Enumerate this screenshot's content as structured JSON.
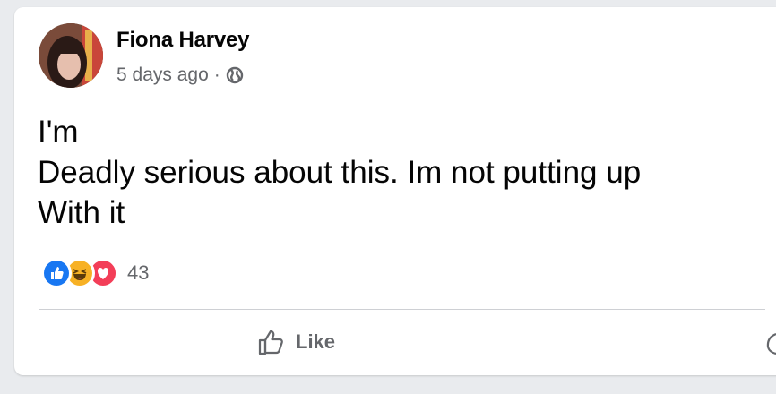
{
  "post": {
    "author": "Fiona Harvey",
    "timestamp": "5 days ago",
    "separator": "·",
    "privacy_icon": "globe-icon",
    "text_lines": [
      "I'm",
      "Deadly serious about this. Im not putting up",
      "With it"
    ],
    "reactions": {
      "icons": [
        "like-reaction-icon",
        "haha-reaction-icon",
        "love-reaction-icon"
      ],
      "count": "43"
    },
    "actions": {
      "like_label": "Like"
    }
  },
  "colors": {
    "like_blue": "#1877f2",
    "haha_yellow": "#f7b125",
    "love_red": "#f33e58",
    "secondary_text": "#65676b"
  }
}
